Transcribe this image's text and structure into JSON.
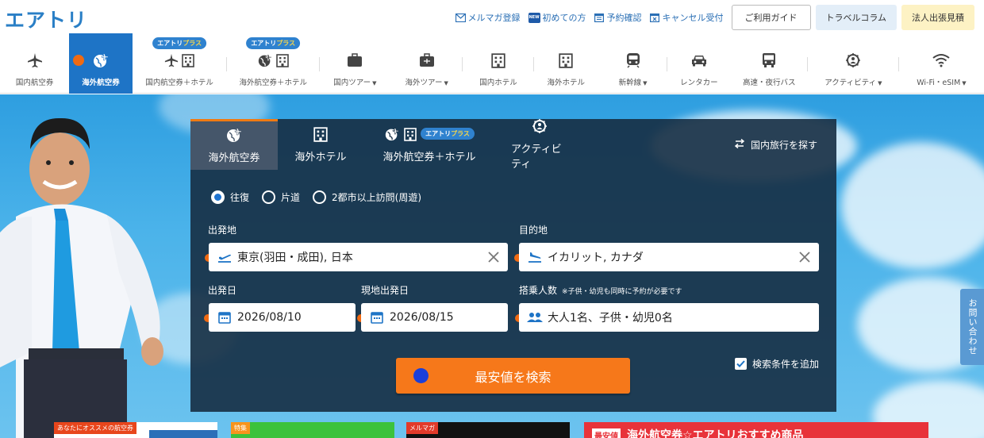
{
  "header": {
    "logo": "エアトリ",
    "links": [
      {
        "label": "メルマガ登録",
        "icon": "mail-icon"
      },
      {
        "label": "初めての方",
        "icon": "new-icon"
      },
      {
        "label": "予約確認",
        "icon": "calendar-icon"
      },
      {
        "label": "キャンセル受付",
        "icon": "cancel-calendar-icon"
      }
    ],
    "new_badge": "NEW",
    "guide_button": "ご利用ガイド",
    "column_button": "トラベルコラム",
    "corp_button": "法人出張見積"
  },
  "nav": {
    "badge_main": "エアトリ",
    "badge_plus": "プラス",
    "items": [
      {
        "label": "国内航空券",
        "icon": "plane-icon"
      },
      {
        "label": "海外航空券",
        "icon": "globe-plane-icon",
        "active": true
      },
      {
        "label": "国内航空券＋ホテル",
        "icon": "plane-hotel-icon",
        "badge": true
      },
      {
        "label": "海外航空券＋ホテル",
        "icon": "globe-hotel-icon",
        "badge": true
      },
      {
        "label": "国内ツアー",
        "icon": "suitcase-icon",
        "caret": true
      },
      {
        "label": "海外ツアー",
        "icon": "suitcase-icon",
        "caret": true
      },
      {
        "label": "国内ホテル",
        "icon": "hotel-icon"
      },
      {
        "label": "海外ホテル",
        "icon": "hotel-icon"
      },
      {
        "label": "新幹線",
        "icon": "train-icon",
        "caret": true
      },
      {
        "label": "レンタカー",
        "icon": "car-icon"
      },
      {
        "label": "高速・夜行バス",
        "icon": "bus-icon"
      },
      {
        "label": "アクティビティ",
        "icon": "activity-icon",
        "caret": true
      },
      {
        "label": "Wi-Fi・eSIM",
        "icon": "wifi-icon",
        "caret": true
      }
    ]
  },
  "search": {
    "tabs": [
      {
        "label": "海外航空券",
        "icon": "globe-plane-icon",
        "active": true
      },
      {
        "label": "海外ホテル",
        "icon": "hotel-icon"
      },
      {
        "label": "海外航空券＋ホテル",
        "icon": "globe-hotel-icon",
        "badge": true
      },
      {
        "label": "アクティビティ",
        "icon": "activity-icon"
      }
    ],
    "domestic_link": "国内旅行を探す",
    "trip_types": [
      {
        "label": "往復",
        "selected": true
      },
      {
        "label": "片道",
        "selected": false
      },
      {
        "label": "2都市以上訪問(周遊)",
        "selected": false
      }
    ],
    "origin_label": "出発地",
    "origin_value": "東京(羽田・成田), 日本",
    "destination_label": "目的地",
    "destination_value": "イカリット, カナダ",
    "depart_label": "出発日",
    "depart_value": "2026/08/10",
    "local_depart_label": "現地出発日",
    "local_depart_value": "2026/08/15",
    "passengers_label": "搭乗人数",
    "passengers_note": "※子供・幼児も同時に予約が必要です",
    "passengers_value": "大人1名、子供・幼児0名",
    "more_conditions": "検索条件を追加",
    "search_button": "最安値を検索"
  },
  "contact_tab": "お問い合わせ",
  "cards": {
    "card1_tag": "あなたにオススメの航空券",
    "card2_tag": "特集",
    "card3_tag": "メルマガ",
    "card4_label": "最安値",
    "card4_title": "海外航空券☆エアトリおすすめ商品"
  },
  "colors": {
    "brand_blue": "#1e74c6",
    "accent_orange": "#f6781a",
    "panel_bg": "#162d42"
  }
}
